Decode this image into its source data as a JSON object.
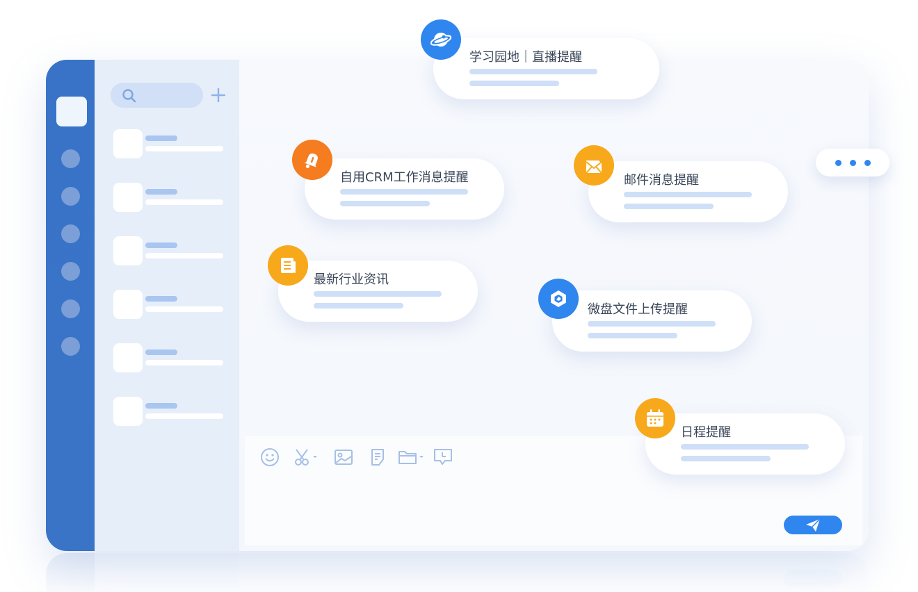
{
  "notifications": {
    "study_live": {
      "title": "学习园地｜直播提醒",
      "icon": "planet-icon"
    },
    "crm": {
      "title": "自用CRM工作消息提醒",
      "icon": "bell-icon"
    },
    "mail": {
      "title": "邮件消息提醒",
      "icon": "envelope-icon"
    },
    "news": {
      "title": "最新行业资讯",
      "icon": "document-icon"
    },
    "drive": {
      "title": "微盘文件上传提醒",
      "icon": "cloud-drive-icon"
    },
    "schedule": {
      "title": "日程提醒",
      "icon": "calendar-icon"
    }
  },
  "colors": {
    "accent_blue": "#2f86ee",
    "rail_blue": "#3873c8",
    "bell_orange": "#f57c1f",
    "amber": "#f7a91b"
  },
  "toolbar": {
    "icons": [
      "emoji-icon",
      "scissors-icon",
      "image-icon",
      "note-icon",
      "folder-icon",
      "history-icon"
    ]
  }
}
